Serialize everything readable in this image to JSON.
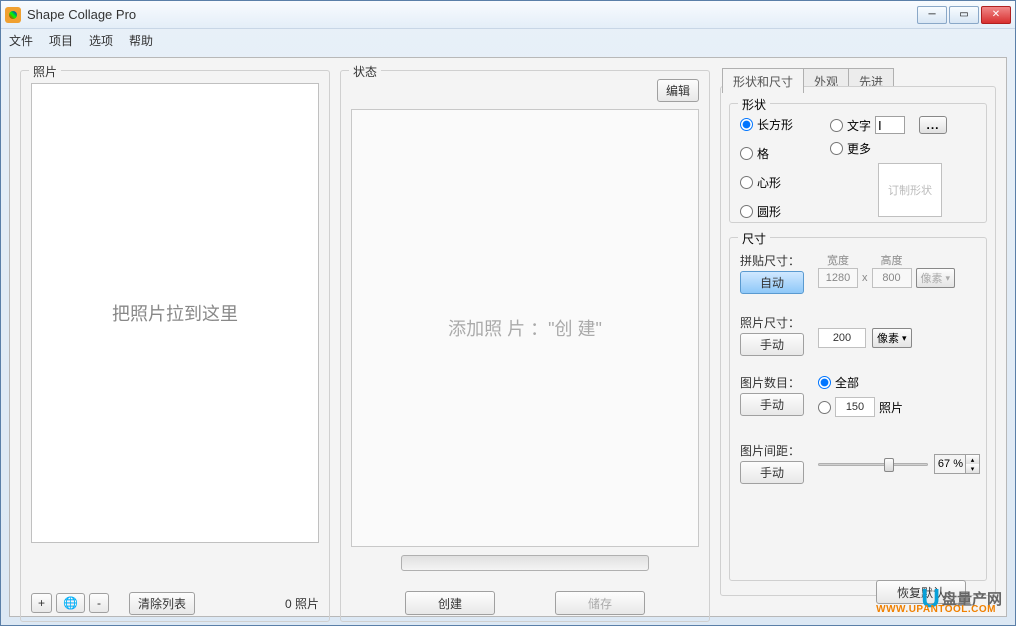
{
  "window": {
    "title": "Shape Collage Pro"
  },
  "menu": {
    "file": "文件",
    "project": "项目",
    "options": "选项",
    "help": "帮助"
  },
  "photos": {
    "label": "照片",
    "drop_hint": "把照片拉到这里",
    "add": "+",
    "web": "🌐",
    "remove": "-",
    "clear": "清除列表",
    "count": "0 照片"
  },
  "status": {
    "label": "状态",
    "edit": "编辑",
    "hint": "添加照 片      ：\"创 建\"",
    "create": "创建",
    "save": "储存"
  },
  "tabs": {
    "shape_size": "形状和尺寸",
    "appearance": "外观",
    "advanced": "先进"
  },
  "shape": {
    "label": "形状",
    "rect": "长方形",
    "grid": "格",
    "heart": "心形",
    "circle": "圆形",
    "text": "文字",
    "text_val": "I",
    "more": "更多",
    "custom": "订制形状",
    "dots": "..."
  },
  "size": {
    "label": "尺寸",
    "collage_label": "拼贴尺寸：",
    "auto": "自动",
    "width_lbl": "宽度",
    "width": "1280",
    "x": "x",
    "height_lbl": "高度",
    "height": "800",
    "unit": "像素",
    "photo_label": "照片尺寸：",
    "manual": "手动",
    "photo_size": "200",
    "count_label": "图片数目：",
    "all": "全部",
    "count_val": "150",
    "photos_suffix": "照片",
    "spacing_label": "图片间距：",
    "spacing_val": "67 %"
  },
  "restore": "恢复默认",
  "watermark": {
    "zh": "盘量产网",
    "url": "WWW.UPANTOOL.COM"
  }
}
